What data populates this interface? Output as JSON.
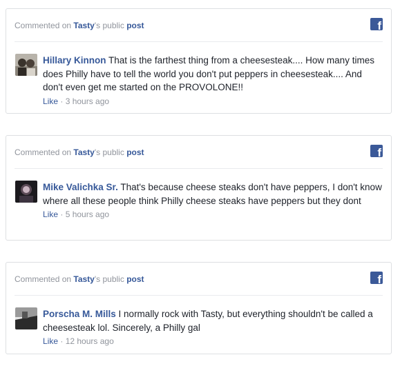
{
  "header": {
    "prefix": "Commented on",
    "page_name": "Tasty",
    "possessive": "'s public",
    "post_link": "post"
  },
  "comments": [
    {
      "author": "Hillary Kinnon",
      "text": "That is the farthest thing from a cheesesteak.... How many times does Philly have to tell the world you don't put peppers in cheesesteak.... And don't even get me started on the PROVOLONE!!",
      "like": "Like",
      "separator": " · ",
      "time": "3 hours ago"
    },
    {
      "author": "Mike Valichka Sr.",
      "text": "That's because cheese steaks don't have peppers, I don't know where all these people think Philly cheese steaks have peppers but they dont",
      "like": "Like",
      "separator": " · ",
      "time": "5 hours ago"
    },
    {
      "author": "Porscha M. Mills",
      "text": "I normally rock with Tasty, but everything shouldn't be called a cheesesteak lol. Sincerely, a Philly gal",
      "like": "Like",
      "separator": " · ",
      "time": "12 hours ago"
    }
  ],
  "icons": {
    "facebook": "facebook-logo-icon",
    "avatar": "user-avatar"
  },
  "colors": {
    "link": "#365899",
    "muted": "#90949c",
    "facebook": "#3b5998"
  }
}
